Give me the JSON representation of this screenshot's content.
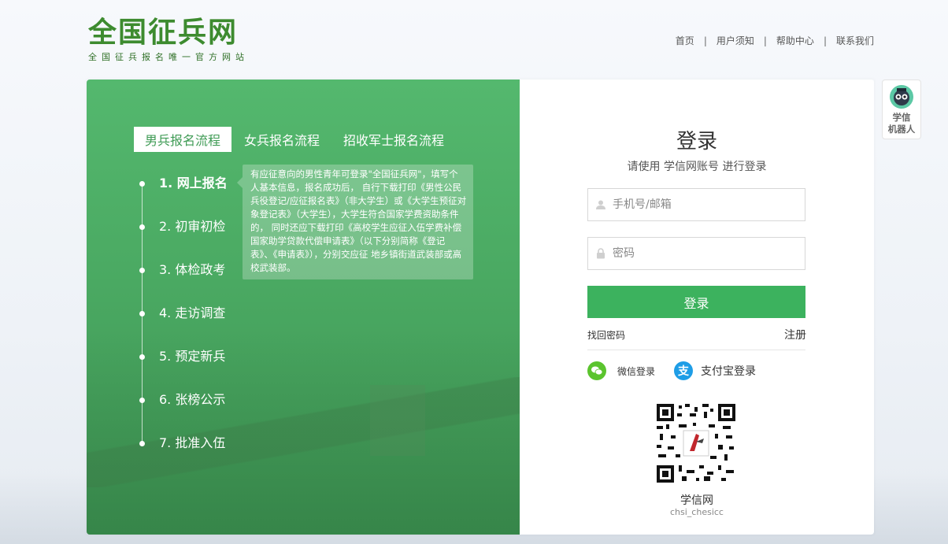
{
  "logo": {
    "title": "全国征兵网",
    "subtitle": "全国征兵报名唯一官方网站"
  },
  "topnav": {
    "items": [
      "首页",
      "用户须知",
      "帮助中心",
      "联系我们"
    ],
    "separator": "|"
  },
  "tabs": [
    {
      "label": "男兵报名流程",
      "active": true
    },
    {
      "label": "女兵报名流程",
      "active": false
    },
    {
      "label": "招收军士报名流程",
      "active": false
    }
  ],
  "steps": [
    {
      "label": "1. 网上报名",
      "active": true
    },
    {
      "label": "2. 初审初检",
      "active": false
    },
    {
      "label": "3. 体检政考",
      "active": false
    },
    {
      "label": "4. 走访调查",
      "active": false
    },
    {
      "label": "5. 预定新兵",
      "active": false
    },
    {
      "label": "6. 张榜公示",
      "active": false
    },
    {
      "label": "7. 批准入伍",
      "active": false
    }
  ],
  "tip": "有应征意向的男性青年可登录\"全国征兵网\"，填写个人基本信息，报名成功后， 自行下载打印《男性公民兵役登记/应征报名表》（非大学生）或《大学生预征对象登记表》（大学生），大学生符合国家学费资助条件的， 同时还应下载打印《高校学生应征入伍学费补偿国家助学贷款代偿申请表》（以下分别简称《登记表》、《申请表》），分别交应征 地乡镇街道武装部或高校武装部。",
  "login": {
    "title": "登录",
    "subtitle": "请使用 学信网账号 进行登录",
    "username_placeholder": "手机号/邮箱",
    "password_placeholder": "密码",
    "button": "登录",
    "forgot": "找回密码",
    "register": "注册",
    "wechat": "微信登录",
    "alipay": "支付宝登录",
    "qr_name": "学信网",
    "qr_sub": "chsi_chesicc"
  },
  "robot": {
    "line1": "学信",
    "line2": "机器人"
  },
  "colors": {
    "brand_green": "#3cb25e",
    "panel_green": "#4aa962",
    "logo_green": "#3d8b2f"
  }
}
